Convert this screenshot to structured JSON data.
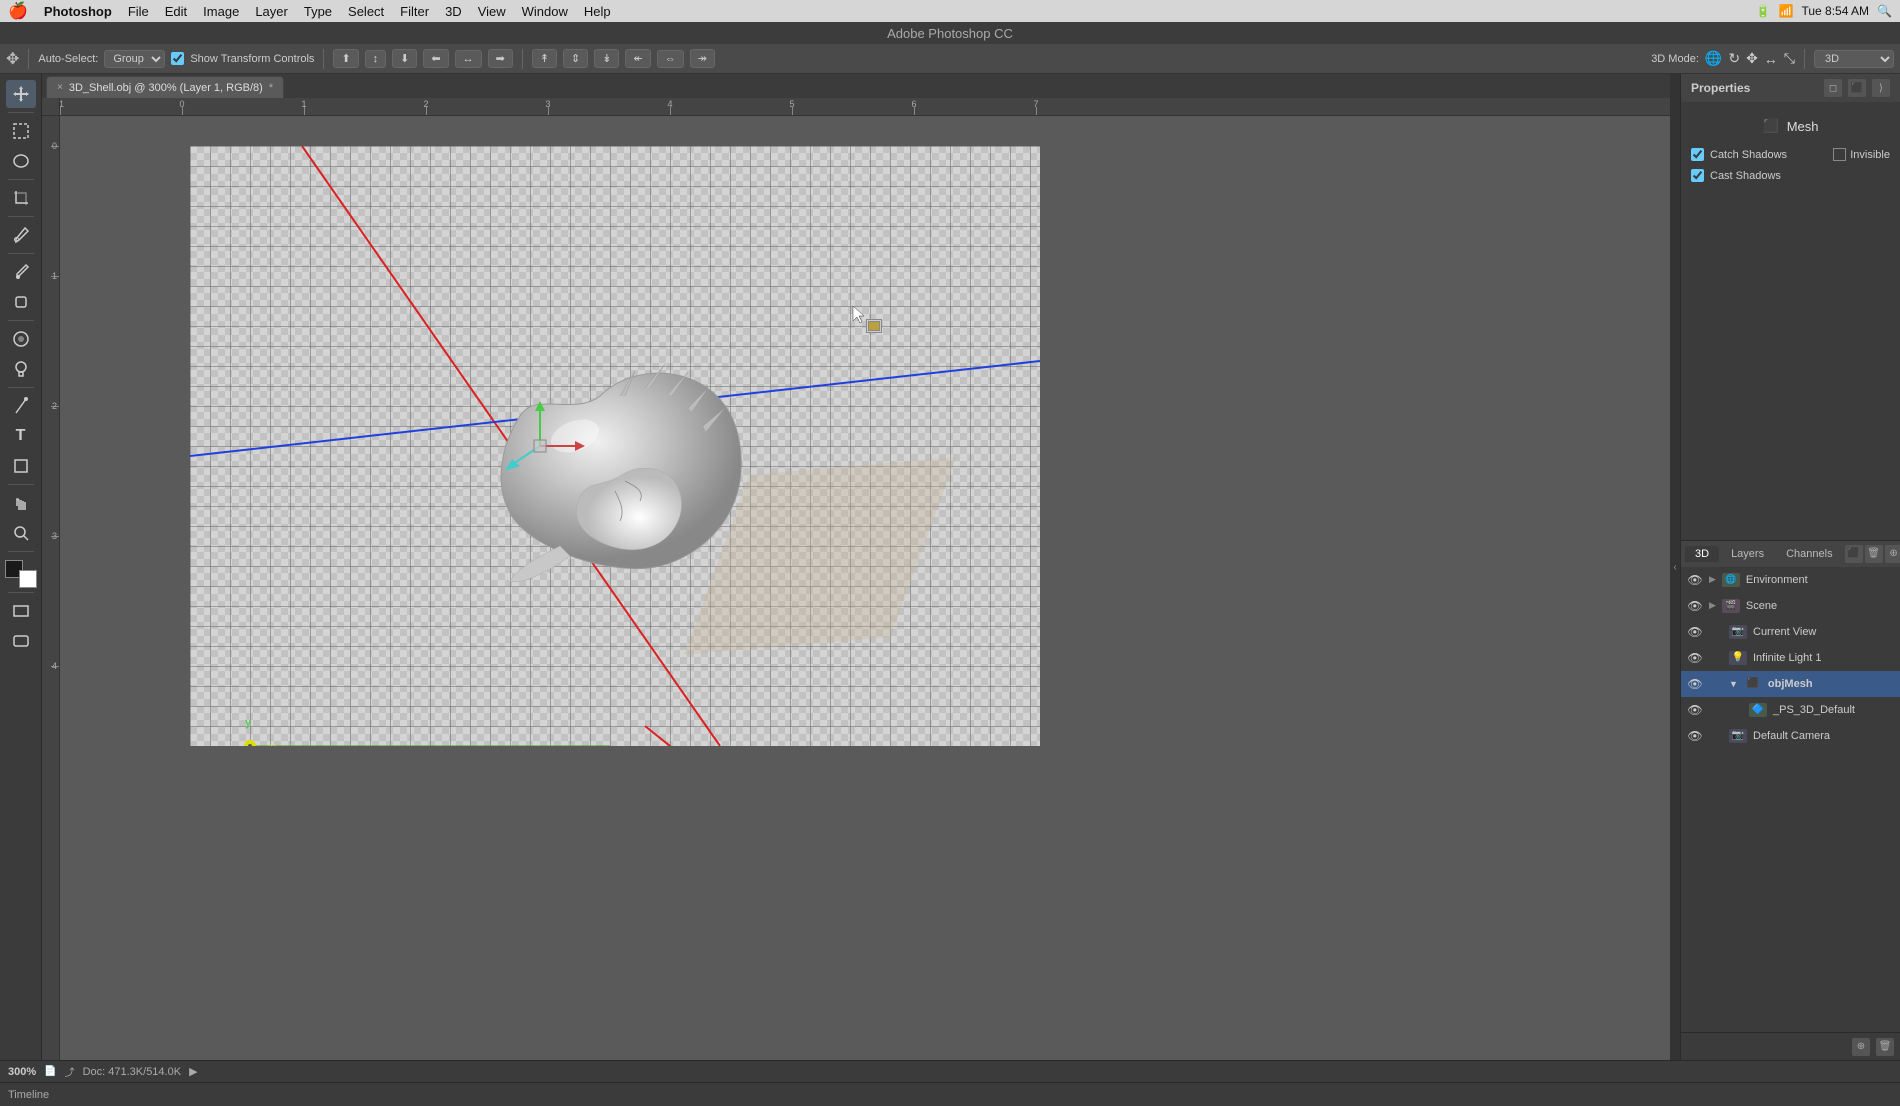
{
  "menubar": {
    "apple": "🍎",
    "items": [
      "Photoshop",
      "File",
      "Edit",
      "Image",
      "Layer",
      "Type",
      "Select",
      "Filter",
      "3D",
      "View",
      "Window",
      "Help"
    ],
    "right": "Tue  8:54 AM"
  },
  "titlebar": {
    "title": "Adobe Photoshop CC"
  },
  "optionsbar": {
    "auto_select_label": "Auto-Select:",
    "group_value": "Group",
    "show_transform": "Show Transform Controls",
    "mode_label": "3D Mode:",
    "mode_value": "3D"
  },
  "tab": {
    "close": "×",
    "name": "3D_Shell.obj @ 300% (Layer 1, RGB/8)",
    "modified": true
  },
  "canvas": {
    "ruler_numbers": [
      "-1",
      "0",
      "1",
      "2",
      "3",
      "4",
      "5",
      "6",
      "7"
    ],
    "left_ruler_numbers": [
      "0",
      "1",
      "2",
      "3",
      "4"
    ]
  },
  "status_bar": {
    "zoom": "300%",
    "doc_info": "Doc: 471.3K/514.0K"
  },
  "properties": {
    "title": "Properties",
    "section": "Mesh",
    "catch_shadows": "Catch Shadows",
    "cast_shadows": "Cast Shadows",
    "invisible": "Invisible"
  },
  "panel_tabs": {
    "tabs": [
      "3D",
      "Layers",
      "Channels"
    ],
    "active": "3D"
  },
  "layers": {
    "items": [
      {
        "id": "env",
        "name": "Environment",
        "indent": 0,
        "type": "env",
        "visible": true,
        "expand": false
      },
      {
        "id": "scene",
        "name": "Scene",
        "indent": 0,
        "type": "scene",
        "visible": true,
        "expand": false
      },
      {
        "id": "current-view",
        "name": "Current View",
        "indent": 1,
        "type": "camera",
        "visible": true,
        "expand": false
      },
      {
        "id": "light1",
        "name": "Infinite Light 1",
        "indent": 1,
        "type": "light",
        "visible": true,
        "expand": false
      },
      {
        "id": "objmesh",
        "name": "objMesh",
        "indent": 1,
        "type": "mesh",
        "visible": true,
        "expand": true,
        "selected": true
      },
      {
        "id": "ps3ddefault",
        "name": "_PS_3D_Default",
        "indent": 2,
        "type": "material",
        "visible": true,
        "expand": false
      },
      {
        "id": "defcam",
        "name": "Default Camera",
        "indent": 1,
        "type": "camera",
        "visible": true,
        "expand": false
      }
    ]
  },
  "timeline": {
    "label": "Timeline"
  },
  "icons": {
    "eye": "👁",
    "mesh": "⬛",
    "camera": "📷",
    "light": "💡",
    "env": "🌐",
    "scene": "🎬",
    "material": "🔷",
    "move": "✥",
    "select_rect": "⬜",
    "lasso": "◯",
    "crop": "⊡",
    "eyedropper": "𝒊",
    "brush": "✏",
    "eraser": "◻",
    "blur": "◎",
    "burn": "◑",
    "pen": "🖊",
    "text": "T",
    "shape": "◻",
    "hand": "✋",
    "zoom": "🔍"
  }
}
